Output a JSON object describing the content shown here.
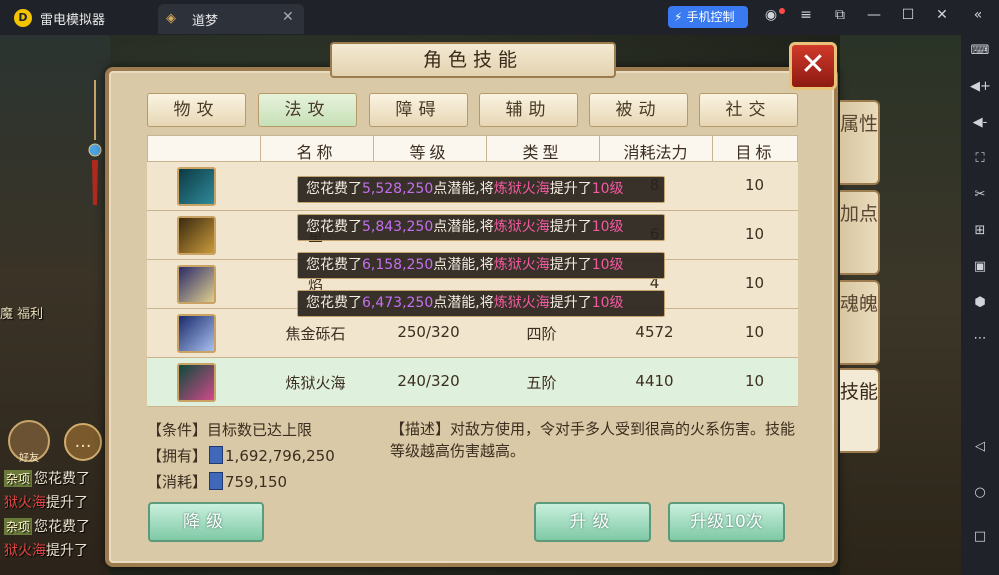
{
  "emulator": {
    "app_name": "雷电模拟器",
    "tab_title": "道梦",
    "phone_control": "手机控制"
  },
  "game": {
    "left_label": "魔 福利",
    "friend_label": "好友",
    "chat": [
      {
        "tag": "杂项",
        "text": "您花费了"
      },
      {
        "red": "狱火海",
        "text": "提升了"
      },
      {
        "tag": "杂项",
        "text": "您花费了"
      },
      {
        "red": "狱火海",
        "text": "提升了"
      }
    ]
  },
  "panel": {
    "title": "角色技能",
    "tabs": [
      "物攻",
      "法攻",
      "障碍",
      "辅助",
      "被动",
      "社交"
    ],
    "active_tab": "法攻",
    "side_tabs": [
      "属性",
      "加点",
      "魂魄",
      "技能"
    ],
    "table": {
      "headers": [
        "名称",
        "等级",
        "类型",
        "消耗法力",
        "目标"
      ],
      "rows": [
        {
          "name": "举",
          "level": "",
          "type": "",
          "cost": "8",
          "target": "10"
        },
        {
          "name": "星",
          "level": "",
          "type": "",
          "cost": "6",
          "target": "10"
        },
        {
          "name": "焰",
          "level": "",
          "type": "",
          "cost": "4",
          "target": "10"
        },
        {
          "name": "焦金砾石",
          "level": "250/320",
          "type": "四阶",
          "cost": "4572",
          "target": "10"
        },
        {
          "name": "炼狱火海",
          "level": "240/320",
          "type": "五阶",
          "cost": "4410",
          "target": "10"
        }
      ]
    },
    "toasts": [
      {
        "pre": "您花费了",
        "num": "5,528,250",
        "mid": "点潜能,将",
        "skill": "炼狱火海",
        "post": "提升了",
        "lvl": "10级"
      },
      {
        "pre": "您花费了",
        "num": "5,843,250",
        "mid": "点潜能,将",
        "skill": "炼狱火海",
        "post": "提升了",
        "lvl": "10级"
      },
      {
        "pre": "您花费了",
        "num": "6,158,250",
        "mid": "点潜能,将",
        "skill": "炼狱火海",
        "post": "提升了",
        "lvl": "10级"
      },
      {
        "pre": "您花费了",
        "num": "6,473,250",
        "mid": "点潜能,将",
        "skill": "炼狱火海",
        "post": "提升了",
        "lvl": "10级"
      }
    ],
    "condition": "【条件】目标数已达上限",
    "own_label": "【拥有】",
    "own_value": "1,692,796,250",
    "cost_label": "【消耗】",
    "cost_value": "759,150",
    "description": "【描述】对敌方使用，令对手多人受到很高的火系伤害。技能等级越高伤害越高。",
    "buttons": {
      "downgrade": "降级",
      "upgrade": "升级",
      "upgrade10": "升级10次"
    }
  }
}
